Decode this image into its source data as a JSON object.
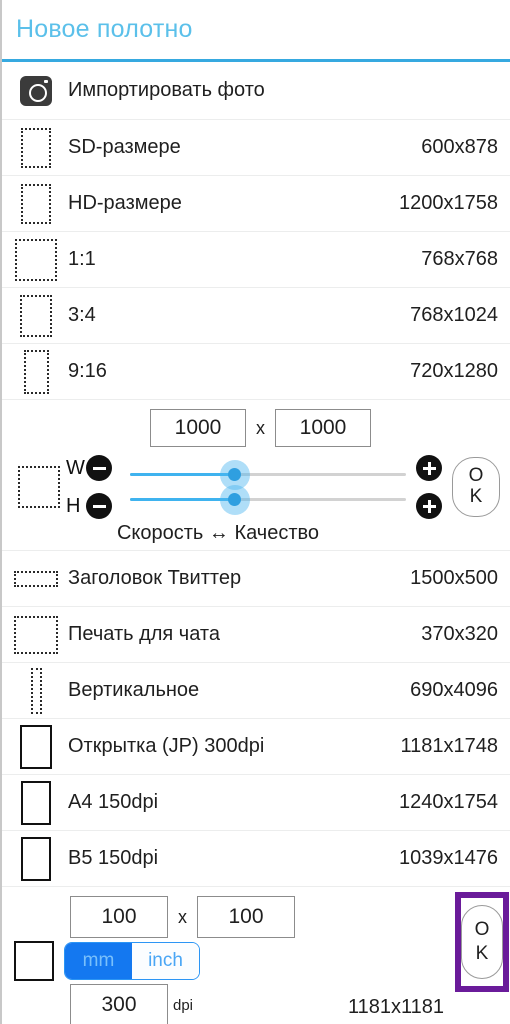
{
  "header": {
    "title": "Новое полотно",
    "accent": "#36a9e0",
    "title_color": "#5bc0ea"
  },
  "import": {
    "label": "Импортировать фото",
    "icon": "camera-icon"
  },
  "presets": [
    {
      "label": "SD-размере",
      "value": "600x878",
      "w": 30,
      "h": 40,
      "style": "dotted"
    },
    {
      "label": "HD-размере",
      "value": "1200x1758",
      "w": 30,
      "h": 40,
      "style": "dotted"
    },
    {
      "label": "1:1",
      "value": "768x768",
      "w": 42,
      "h": 42,
      "style": "dotted"
    },
    {
      "label": "3:4",
      "value": "768x1024",
      "w": 32,
      "h": 42,
      "style": "dotted"
    },
    {
      "label": "9:16",
      "value": "720x1280",
      "w": 25,
      "h": 44,
      "style": "dotted"
    }
  ],
  "custom": {
    "width_value": "1000",
    "height_value": "1000",
    "separator": "x",
    "w_letter": "W",
    "h_letter": "H",
    "minus_label": "−",
    "plus_label": "+",
    "ok_line1": "O",
    "ok_line2": "K",
    "quality_label": "Скорость ↔ Качество",
    "w_slider_percent": 38,
    "h_slider_percent": 38,
    "track_fill_color": "#3fb3ef"
  },
  "presets2": [
    {
      "label": "Заголовок Твиттер",
      "value": "1500x500",
      "w": 44,
      "h": 16,
      "style": "dotted"
    },
    {
      "label": "Печать для чата",
      "value": "370x320",
      "w": 44,
      "h": 38,
      "style": "dotted"
    },
    {
      "label": "Вертикальное",
      "value": "690x4096",
      "w": 11,
      "h": 46,
      "style": "dotted"
    },
    {
      "label": "Открытка (JP) 300dpi",
      "value": "1181x1748",
      "w": 32,
      "h": 44,
      "style": "solid"
    },
    {
      "label": "A4 150dpi",
      "value": "1240x1754",
      "w": 30,
      "h": 44,
      "style": "solid"
    },
    {
      "label": "B5 150dpi",
      "value": "1039x1476",
      "w": 30,
      "h": 44,
      "style": "solid"
    }
  ],
  "print": {
    "width_value": "100",
    "height_value": "100",
    "separator": "x",
    "unit_mm": "mm",
    "unit_inch": "inch",
    "selected_unit": "mm",
    "dpi_value": "300",
    "dpi_label": "dpi",
    "result": "1181x1181",
    "ok_line1": "O",
    "ok_line2": "K",
    "highlight_color": "#6a1b9a",
    "active_color": "#1478f0"
  }
}
